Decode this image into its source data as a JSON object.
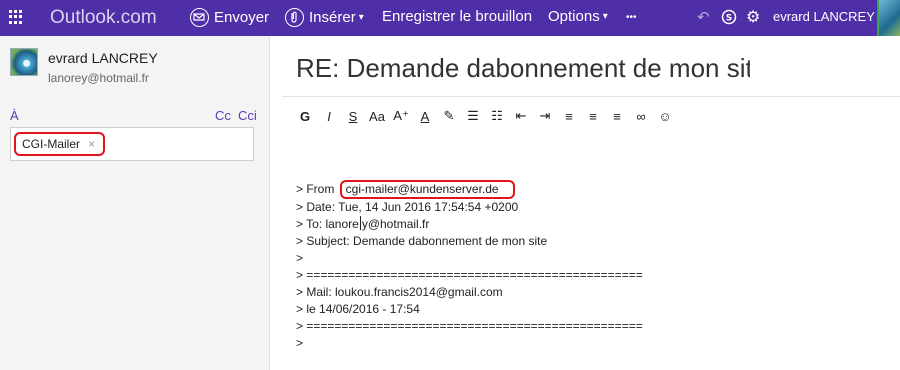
{
  "topbar": {
    "brand": "Outlook.com",
    "send_label": "Envoyer",
    "insert_label": "Insérer",
    "save_draft_label": "Enregistrer le brouillon",
    "options_label": "Options",
    "more_label": "•••",
    "user_name": "evrard LANCREY",
    "background_color": "#4e2fa7"
  },
  "sender": {
    "name": "evrard LANCREY",
    "email": "lanorey@hotmail.fr"
  },
  "recipients": {
    "to_label": "À",
    "cc_label": "Cc",
    "bcc_label": "Cci",
    "chip": "CGI-Mailer",
    "chip_remove": "×",
    "highlight_color": "#e0141b"
  },
  "compose": {
    "subject": "RE: Demande dabonnement de mon site",
    "toolbar": [
      {
        "name": "bold-button",
        "glyph": "G",
        "style": "bold"
      },
      {
        "name": "italic-button",
        "glyph": "I",
        "style": "italic"
      },
      {
        "name": "underline-button",
        "glyph": "S",
        "style": "underline"
      },
      {
        "name": "font-size-button",
        "glyph": "Aa",
        "style": ""
      },
      {
        "name": "grow-font-button",
        "glyph": "A⁺",
        "style": ""
      },
      {
        "name": "font-color-button",
        "glyph": "A",
        "style": "underline"
      },
      {
        "name": "highlight-button",
        "glyph": "✎",
        "style": ""
      },
      {
        "name": "numbered-list-button",
        "glyph": "☰",
        "style": ""
      },
      {
        "name": "bullet-list-button",
        "glyph": "☷",
        "style": ""
      },
      {
        "name": "decrease-indent-button",
        "glyph": "⇤",
        "style": ""
      },
      {
        "name": "increase-indent-button",
        "glyph": "⇥",
        "style": ""
      },
      {
        "name": "align-left-button",
        "glyph": "≡",
        "style": ""
      },
      {
        "name": "align-center-button",
        "glyph": "≡",
        "style": ""
      },
      {
        "name": "align-right-button",
        "glyph": "≡",
        "style": ""
      },
      {
        "name": "insert-link-button",
        "glyph": "∞",
        "style": ""
      },
      {
        "name": "emoji-button",
        "glyph": "☺",
        "style": ""
      }
    ],
    "body": {
      "from_prefix": "> From ",
      "from_value": "cgi-mailer@kundenserver.de",
      "date_line": "> Date: Tue, 14 Jun 2016 17:54:54 +0200",
      "to_line_start": "> To: lanore",
      "to_line_end": "y@hotmail.fr",
      "subject_line": "> Subject: Demande dabonnement de mon site",
      "blank_line": ">",
      "separator_1": "> ================================================",
      "mail_line": "> Mail: loukou.francis2014@gmail.com",
      "le_line": "> le 14/06/2016 - 17:54",
      "separator_2": "> ================================================",
      "last_line": ">"
    }
  }
}
